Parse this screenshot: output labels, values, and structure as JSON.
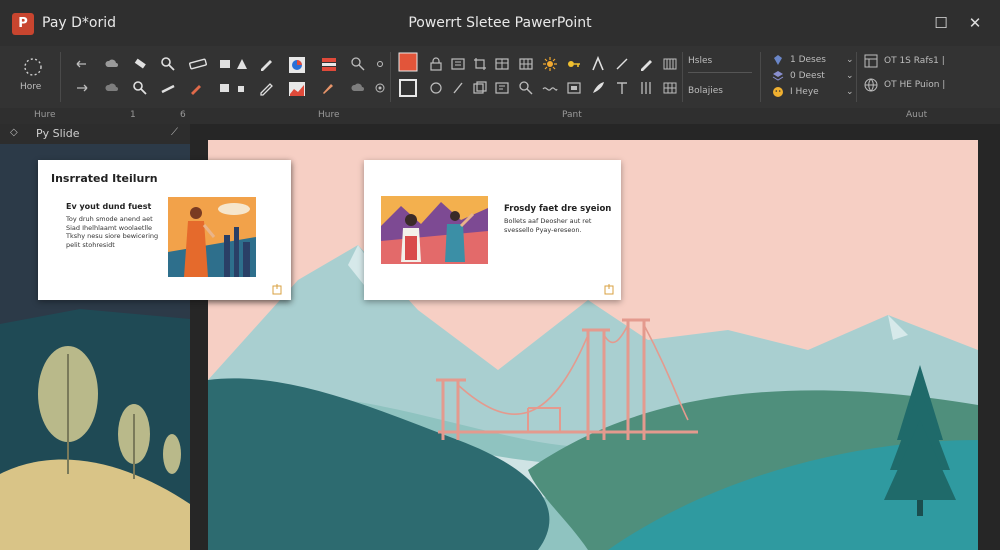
{
  "app": {
    "logo_letter": "P",
    "name": "Pay D*orid",
    "window_title": "Powerrt Sletee PawerPoint"
  },
  "window_controls": {
    "maximize": "☐",
    "close": "✕"
  },
  "ribbon": {
    "more_label": "Hore",
    "style_labels": [
      "Hsles",
      "Bolajies"
    ],
    "right_labels": [
      "1 Deses",
      "0 Deest",
      "I Heye"
    ],
    "far_right_labels": [
      "OT 1S Rafs1 |",
      "OT HE Puion |"
    ],
    "groups": [
      "Hure",
      "1",
      "6",
      "Hure",
      "Pant",
      "Auut"
    ]
  },
  "left_panel": {
    "title": "Py Slide"
  },
  "cards": [
    {
      "title": "Insrrated Iteilurn",
      "subtitle": "Ev yout dund fuest",
      "body": "Toy druh smode anend aet Siad Ihelhlaamt woolaetlle Tkshy nesu siore bewicering pelit stohresidt"
    },
    {
      "title": "Frosdy faet dre syeion",
      "body": "Bollets aaf Deosher aut ret svessello Pyay-ereseon."
    }
  ],
  "colors": {
    "accent": "#c8452f",
    "ribbon_bg": "#333333",
    "titlebar_bg": "#2f2f2f",
    "slide_sky": "#f6cfc4",
    "bridge": "#e49a8e"
  }
}
